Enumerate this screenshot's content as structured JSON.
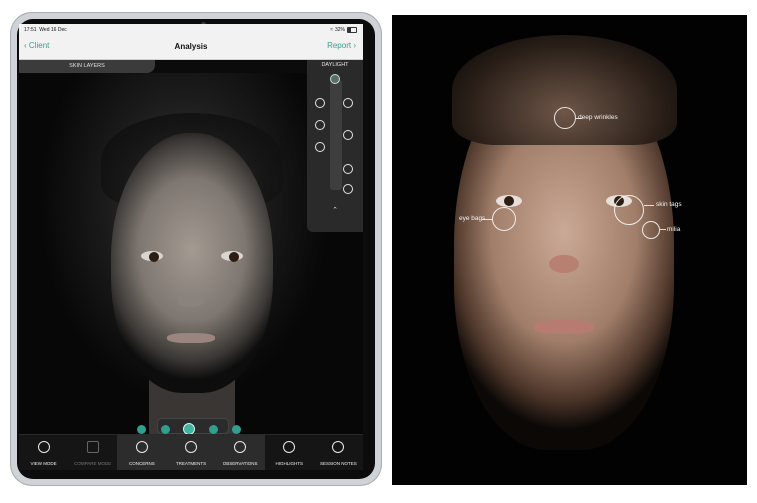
{
  "status_bar": {
    "time": "17:51",
    "date": "Wed 16 Dec",
    "wifi_icon": "wifi-icon",
    "battery": "32%"
  },
  "nav": {
    "back_label": "Client",
    "title": "Analysis",
    "report_label": "Report"
  },
  "skin_layers_label": "SKIN LAYERS",
  "light_panel": {
    "mode_label": "DAYLIGHT"
  },
  "toolbar": {
    "items": [
      {
        "label": "VIEW MODE",
        "icon": "camera-icon",
        "state": "normal"
      },
      {
        "label": "COMPARE MODE",
        "icon": "compare-icon",
        "state": "disabled"
      },
      {
        "label": "CONCERNS",
        "icon": "concerns-face-icon",
        "state": "active"
      },
      {
        "label": "TREATMENTS",
        "icon": "treatments-icon",
        "state": "active"
      },
      {
        "label": "OBSERVATIONS",
        "icon": "observations-icon",
        "state": "active"
      },
      {
        "label": "HIGHLIGHTS",
        "icon": "highlights-icon",
        "state": "normal"
      },
      {
        "label": "SESSION NOTES",
        "icon": "session-notes-icon",
        "state": "normal"
      }
    ]
  },
  "annotations": {
    "deep_wrinkles": "deep wrinkles",
    "eye_bags": "eye bags",
    "skin_tags": "skin tags",
    "milia": "milia"
  },
  "colors": {
    "accent": "#3a9d8c",
    "teal_dot": "#2f9f90"
  }
}
